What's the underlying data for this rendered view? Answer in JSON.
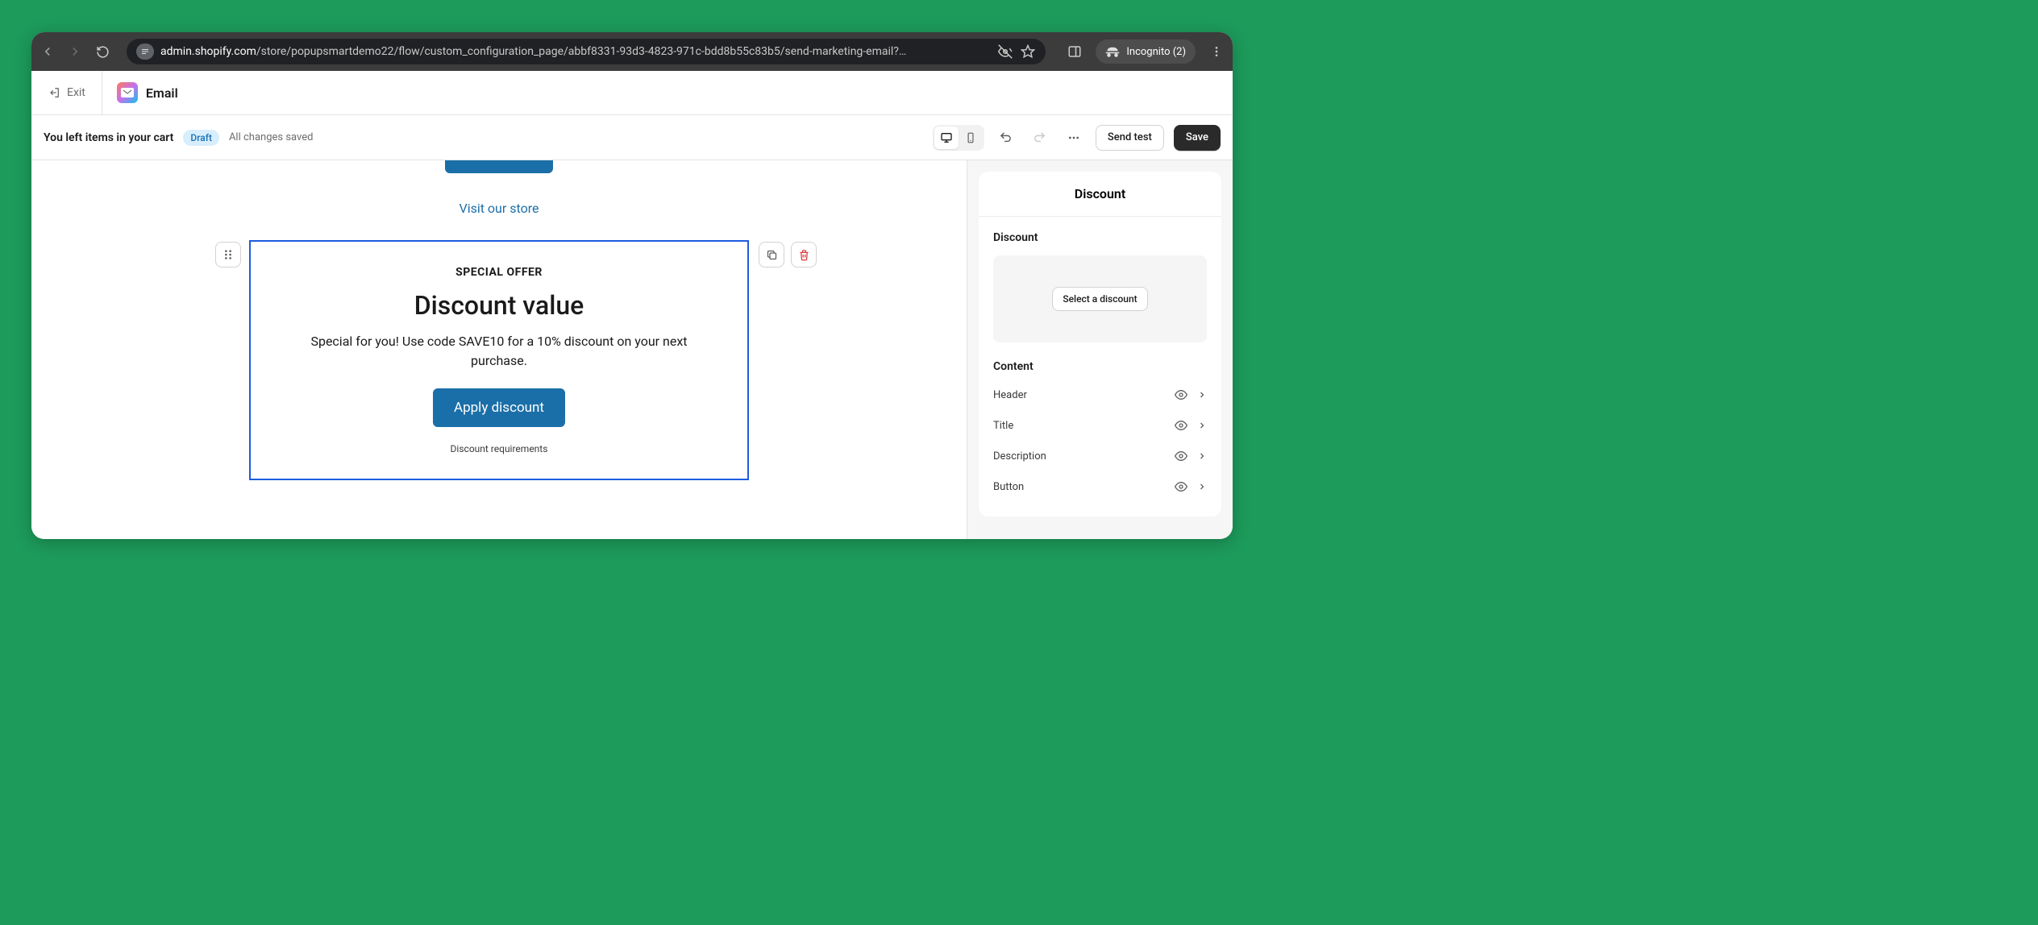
{
  "browser": {
    "url_domain": "admin.shopify.com",
    "url_path": "/store/popupsmartdemo22/flow/custom_configuration_page/abbf8331-93d3-4823-971c-bdd8b55c83b5/send-marketing-email?…",
    "incognito_label": "Incognito (2)"
  },
  "app": {
    "exit": "Exit",
    "title": "Email"
  },
  "subject_bar": {
    "subject": "You left items in your cart",
    "badge": "Draft",
    "save_status": "All changes saved",
    "send_test": "Send test",
    "save": "Save"
  },
  "canvas": {
    "visit_store": "Visit our store",
    "special": "SPECIAL OFFER",
    "title": "Discount value",
    "description": "Special for you! Use code SAVE10 for a 10% discount on your next purchase.",
    "apply_button": "Apply discount",
    "requirements": "Discount requirements"
  },
  "sidebar": {
    "panel_title": "Discount",
    "discount_label": "Discount",
    "select_discount": "Select a discount",
    "content_label": "Content",
    "items": [
      {
        "label": "Header"
      },
      {
        "label": "Title"
      },
      {
        "label": "Description"
      },
      {
        "label": "Button"
      }
    ]
  }
}
